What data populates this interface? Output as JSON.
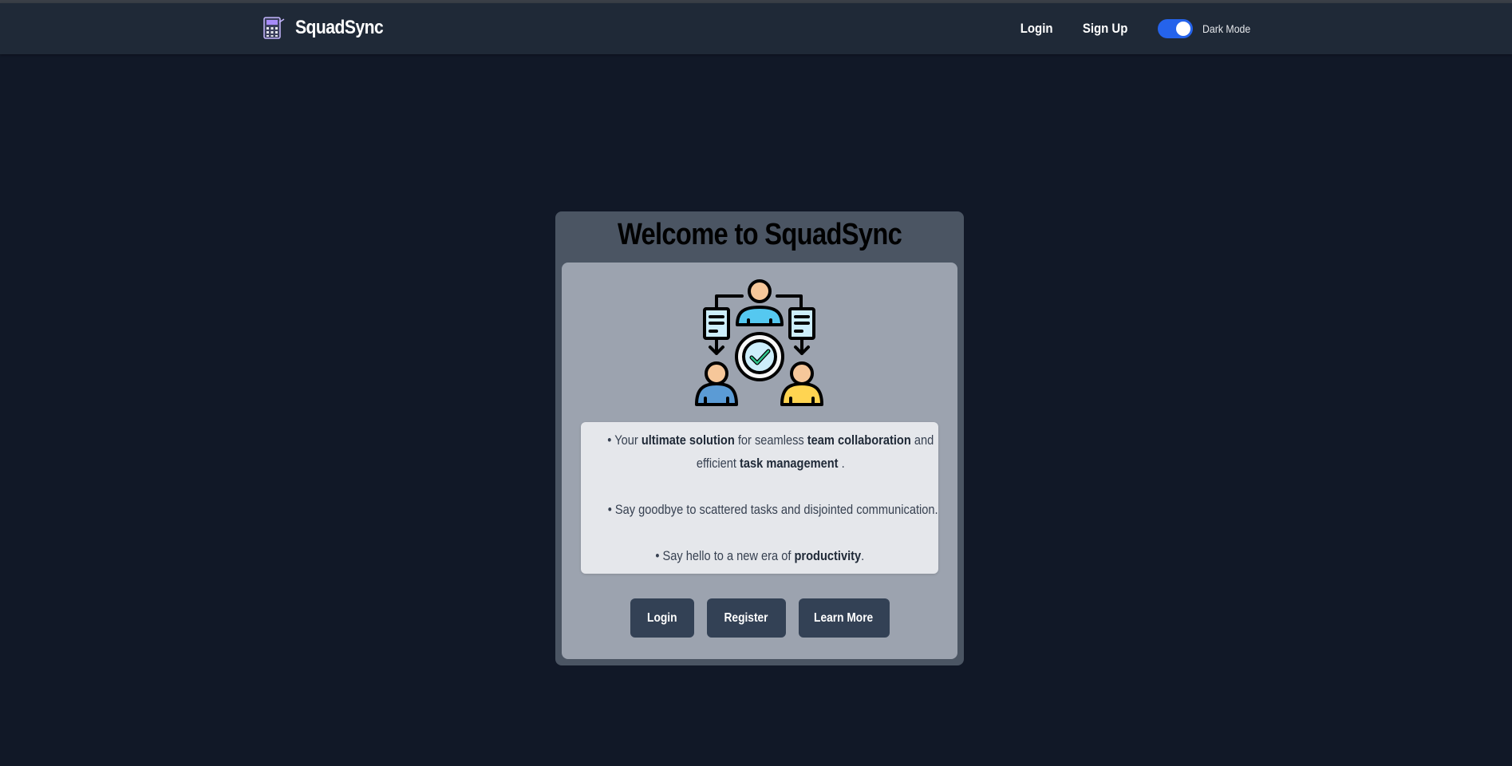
{
  "navbar": {
    "brand": "SquadSync",
    "links": {
      "login": "Login",
      "signup": "Sign Up"
    },
    "dark_mode": {
      "label": "Dark Mode",
      "enabled": true
    }
  },
  "welcome": {
    "title": "Welcome to SquadSync",
    "line1": {
      "a": "• Your ",
      "b": "ultimate solution",
      "c": " for seamless ",
      "d": "team collaboration",
      "e": " and"
    },
    "line2": {
      "a": "efficient ",
      "b": "task management",
      "c": " ."
    },
    "line3": "• Say goodbye to scattered tasks and disjointed communication.",
    "line4": {
      "a": "• Say hello to a new era of ",
      "b": "productivity",
      "c": "."
    },
    "buttons": {
      "login": "Login",
      "register": "Register",
      "learn_more": "Learn More"
    }
  },
  "colors": {
    "page_background": "#111827",
    "navbar_background": "#1f2937",
    "toggle_accent": "#2563eb",
    "card_outer": "#4b5563",
    "card_inner": "#9ca3af",
    "text_box": "#e5e7eb",
    "button": "#334155"
  },
  "icons": {
    "brand": "calculator-logo-icon",
    "hero": "team-collaboration-illustration"
  }
}
